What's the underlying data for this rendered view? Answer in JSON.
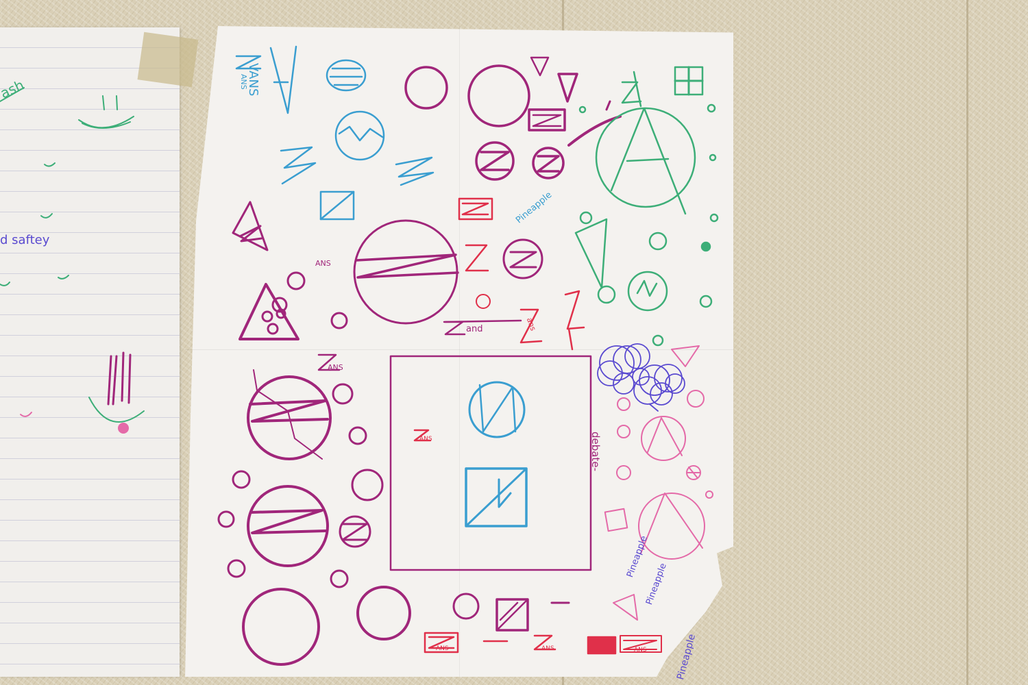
{
  "colors": {
    "magenta": "#a0267a",
    "red": "#e0304a",
    "blue": "#3a9ed0",
    "green": "#3dae78",
    "purple": "#5a4ad0",
    "pink": "#e46aa8"
  },
  "left_sheet": {
    "word_top": "ash",
    "word_safety": "d saftey"
  },
  "main_sheet": {
    "vans_label": "VANS",
    "zans_label_blue": "ANS",
    "ans_small_1": "ANS",
    "zand_label": "and",
    "ans_mid": "ans",
    "pineapple_1": "Pineapple",
    "debate_label": "debate-",
    "ans_big": "ANS",
    "ans_box": "ANS",
    "pineapple_2": "Pineapple",
    "pineapple_3": "Pineapple",
    "pineapple_4": "Pineapple",
    "bottom_ans_1": "ANS",
    "bottom_ans_2": "ANS",
    "bottom_ans_3": "ANS"
  }
}
